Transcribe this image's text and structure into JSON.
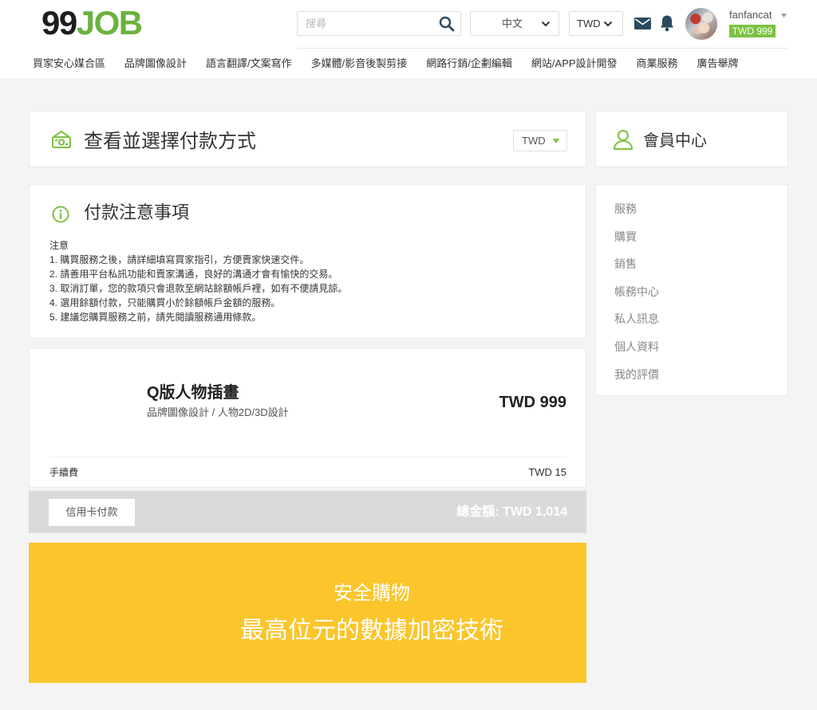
{
  "header": {
    "logo": {
      "part1": "99",
      "part2": "JOB"
    },
    "search": {
      "placeholder": "搜尋"
    },
    "language": {
      "selected": "中文"
    },
    "currency": {
      "selected": "TWD"
    },
    "user": {
      "name": "fanfancat",
      "balance": "TWD 999"
    }
  },
  "nav": {
    "items": [
      "買家安心媒合區",
      "品牌圖像設計",
      "語言翻譯/文案寫作",
      "多媒體/影音後製剪接",
      "網路行銷/企劃編輯",
      "網站/APP設計開發",
      "商業服務",
      "廣告舉牌"
    ]
  },
  "payment_method": {
    "title": "查看並選擇付款方式",
    "currency": "TWD"
  },
  "notice": {
    "title": "付款注意事項",
    "heading": "注意",
    "items": [
      "1. 購買服務之後，請詳細填寫買家指引，方便賣家快速交件。",
      "2. 請善用平台私訊功能和賣家溝通，良好的溝通才會有愉快的交易。",
      "3. 取消訂單，您的款項只會退款至網站餘額帳戶裡，如有不便請見諒。",
      "4. 選用餘額付款，只能購買小於餘額帳戶金額的服務。",
      "5. 建議您購買服務之前，請先閱讀服務通用條款。"
    ]
  },
  "order": {
    "service_title": "Q版人物插畫",
    "category": "品牌圖像設計 / 人物2D/3D設計",
    "price": "TWD 999",
    "fee_label": "手續費",
    "fee": "TWD 15",
    "pay_button": "信用卡付款",
    "total_label": "總金額:",
    "total": "TWD 1,014"
  },
  "banner": {
    "line1": "安全購物",
    "line2": "最高位元的數據加密技術"
  },
  "sidebar": {
    "title": "會員中心",
    "items": [
      "服務",
      "購買",
      "銷售",
      "帳務中心",
      "私人訊息",
      "個人資料",
      "我的評價"
    ]
  },
  "icons": {
    "search": "search-icon",
    "dropdown": "chevron-down-icon",
    "mail": "mail-icon",
    "notifications": "bell-icon",
    "user_menu": "caret-down-icon",
    "payment": "money-icon",
    "payment_currency": "triangle-down-icon",
    "notice": "info-icon",
    "member": "user-icon"
  },
  "colors": {
    "brand_green": "#6ab23e",
    "accent_green": "#7cc242",
    "icon_navy": "#2c4a5e",
    "banner_yellow": "#fbc52b",
    "total_bar_gray": "#dadada",
    "page_bg": "#f4f4f4"
  }
}
